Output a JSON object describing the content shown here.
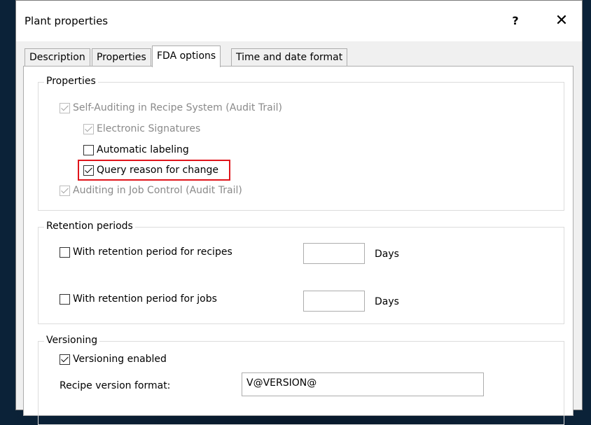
{
  "window": {
    "title": "Plant properties",
    "help_label": "?",
    "close_label": "✕"
  },
  "tabs": [
    {
      "label": "Description",
      "active": false
    },
    {
      "label": "Properties",
      "active": false
    },
    {
      "label": "FDA options",
      "active": true
    },
    {
      "label": "Time and date format",
      "active": false
    }
  ],
  "properties_group": {
    "legend": "Properties",
    "items": [
      {
        "label": "Self-Auditing in Recipe System (Audit Trail)",
        "checked": true,
        "enabled": false
      },
      {
        "label": "Electronic Signatures",
        "checked": true,
        "enabled": false
      },
      {
        "label": "Automatic labeling",
        "checked": false,
        "enabled": true
      },
      {
        "label": "Query reason for change",
        "checked": true,
        "enabled": true,
        "highlighted": true
      },
      {
        "label": "Auditing in Job Control (Audit Trail)",
        "checked": true,
        "enabled": false
      }
    ]
  },
  "retention_group": {
    "legend": "Retention periods",
    "recipes": {
      "label": "With retention period for recipes",
      "checked": false,
      "value": "",
      "unit": "Days"
    },
    "jobs": {
      "label": "With retention period for jobs",
      "checked": false,
      "value": "",
      "unit": "Days"
    }
  },
  "versioning_group": {
    "legend": "Versioning",
    "enabled": {
      "label": "Versioning enabled",
      "checked": true
    },
    "format_label": "Recipe version format:",
    "format_value": "V@VERSION@"
  },
  "colors": {
    "highlight": "#e0151b",
    "dialog_bg": "#f0f0f0",
    "panel_bg": "#ffffff"
  }
}
